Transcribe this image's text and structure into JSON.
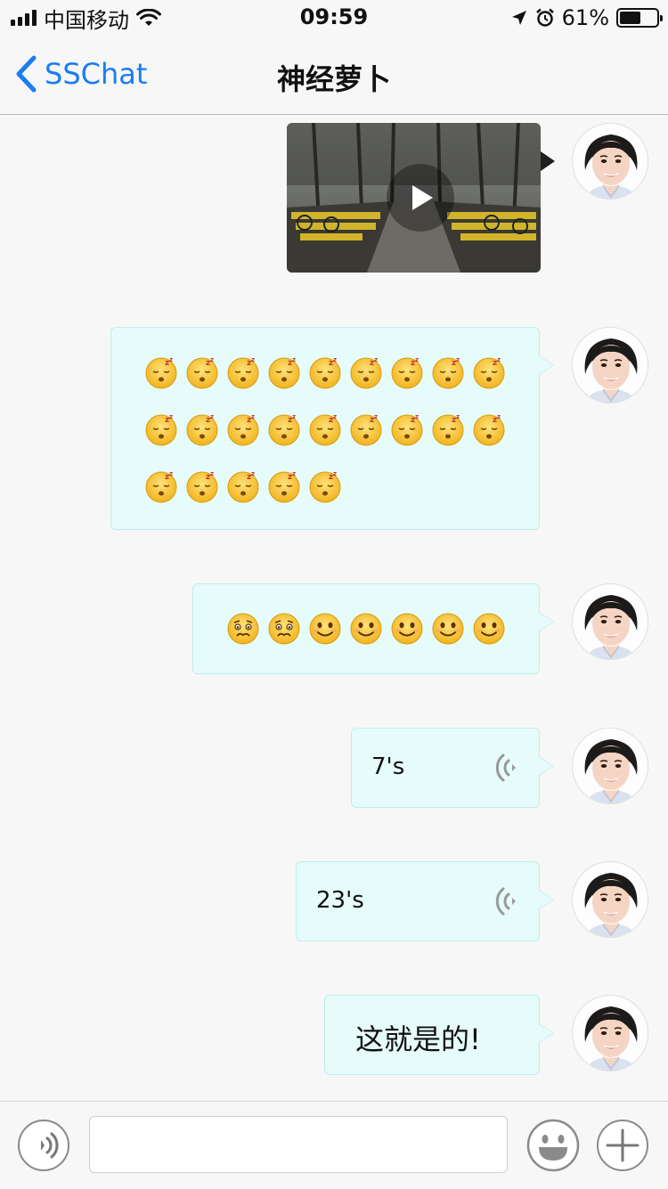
{
  "status_bar": {
    "carrier": "中国移动",
    "time": "09:59",
    "battery_percent": "61%",
    "battery_level": 0.61
  },
  "nav": {
    "back_label": "SSChat",
    "title": "神经萝卜"
  },
  "messages": {
    "emoji_row1": [
      "sleep-face-emoji",
      "sleep-face-emoji",
      "sleep-face-emoji",
      "sleep-face-emoji",
      "sleep-face-emoji",
      "sleep-face-emoji",
      "sleep-face-emoji",
      "sleep-face-emoji",
      "sleep-face-emoji"
    ],
    "emoji_row2": [
      "sleep-face-emoji",
      "sleep-face-emoji",
      "sleep-face-emoji",
      "sleep-face-emoji",
      "sleep-face-emoji",
      "sleep-face-emoji",
      "sleep-face-emoji",
      "sleep-face-emoji",
      "sleep-face-emoji"
    ],
    "emoji_row3": [
      "sleep-face-emoji",
      "sleep-face-emoji",
      "sleep-face-emoji",
      "sleep-face-emoji",
      "sleep-face-emoji"
    ],
    "emoji_mixed": [
      "worried-face-emoji",
      "worried-face-emoji",
      "smile-face-emoji",
      "smile-face-emoji",
      "smile-face-emoji",
      "smile-face-emoji",
      "smile-face-emoji"
    ],
    "voice1_duration": "7's",
    "voice2_duration": "23's",
    "text_message": "这就是的!"
  },
  "colors": {
    "accent": "#1a7df5",
    "bubble_bg": "#e6fcfa",
    "bubble_border": "#bfeee9",
    "emoji_yellow": "#f7c531"
  },
  "input_bar": {
    "placeholder": ""
  }
}
